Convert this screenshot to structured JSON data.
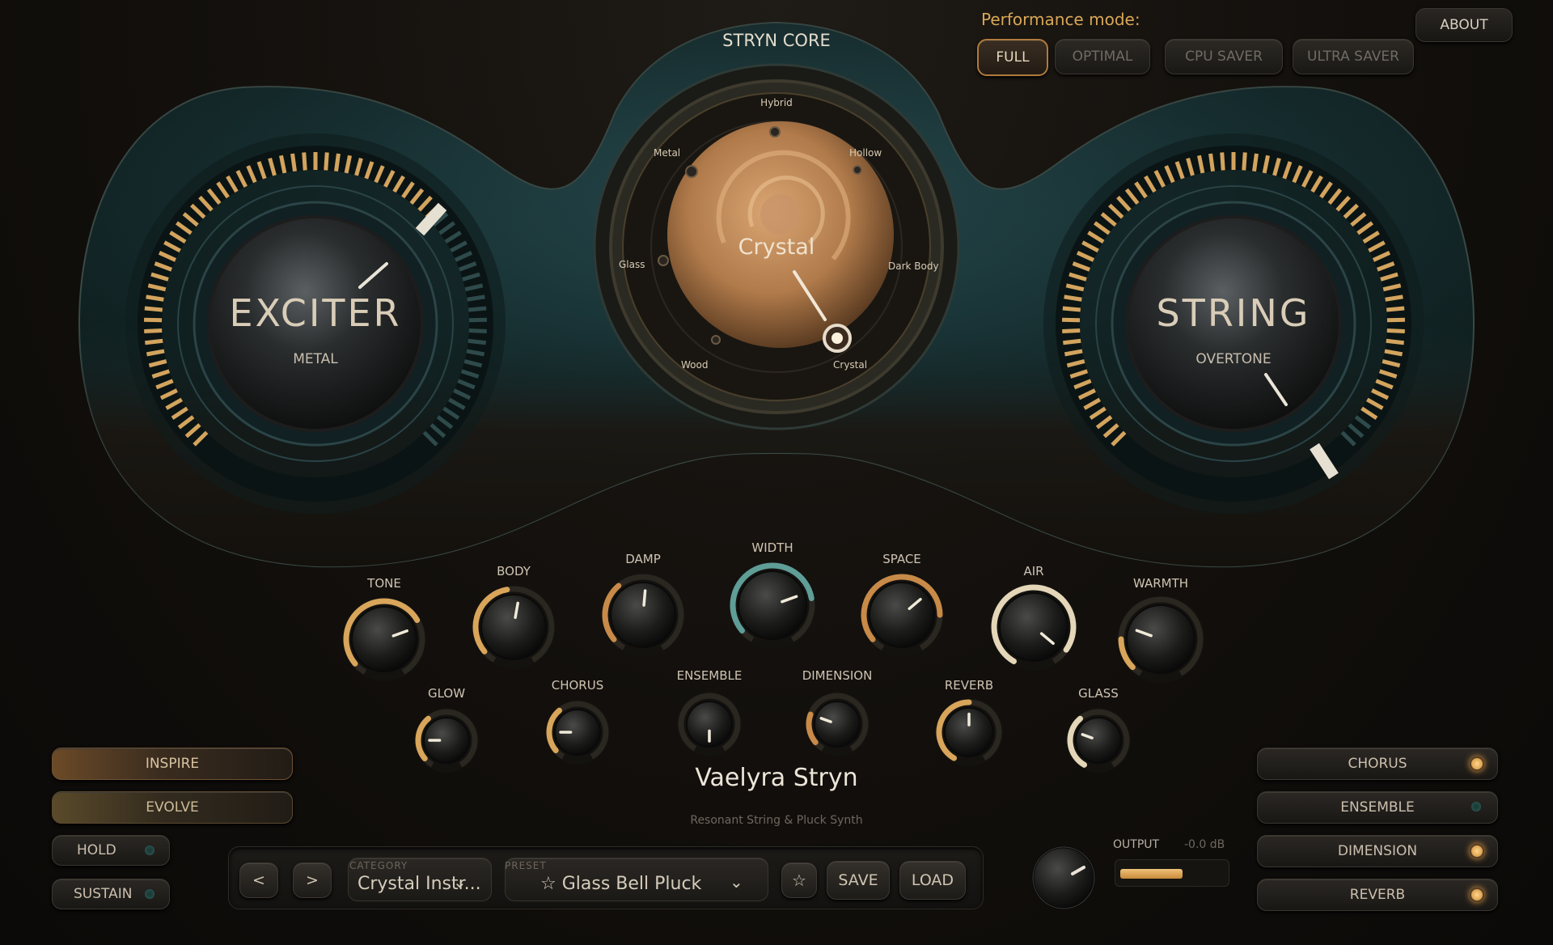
{
  "performance": {
    "title": "Performance mode:",
    "modes": [
      "FULL",
      "OPTIMAL",
      "CPU SAVER",
      "ULTRA SAVER"
    ],
    "active": "FULL"
  },
  "about_label": "ABOUT",
  "core": {
    "title": "STRYN CORE",
    "current": "Crystal",
    "points": [
      "Hybrid",
      "Hollow",
      "Dark Body",
      "Crystal",
      "Wood",
      "Glass",
      "Metal"
    ]
  },
  "exciter": {
    "title": "EXCITER",
    "type": "METAL"
  },
  "string": {
    "title": "STRING",
    "type": "OVERTONE"
  },
  "knobs": {
    "tone": "TONE",
    "body": "BODY",
    "damp": "DAMP",
    "width": "WIDTH",
    "space": "SPACE",
    "air": "AIR",
    "warmth": "WARMTH",
    "glow": "GLOW",
    "chorus": "CHORUS",
    "ensemble": "ENSEMBLE",
    "dimension": "DIMENSION",
    "reverb": "REVERB",
    "glass": "GLASS"
  },
  "left_buttons": {
    "inspire": "INSPIRE",
    "evolve": "EVOLVE",
    "hold": "HOLD",
    "sustain": "SUSTAIN"
  },
  "right_buttons": {
    "chorus": "CHORUS",
    "ensemble": "ENSEMBLE",
    "dimension": "DIMENSION",
    "reverb": "REVERB"
  },
  "effects_on": {
    "chorus": true,
    "ensemble": false,
    "dimension": true,
    "reverb": true
  },
  "product": {
    "name": "Vaelyra Stryn",
    "subtitle": "Resonant String & Pluck Synth"
  },
  "preset_bar": {
    "prev": "<",
    "next": ">",
    "category_label": "CATEGORY",
    "category_value": "Crystal Instr...",
    "preset_label": "PRESET",
    "preset_value": "☆ Glass Bell Pluck",
    "favorite": "☆",
    "save": "SAVE",
    "load": "LOAD"
  },
  "output": {
    "label": "OUTPUT",
    "db": "-0.0 dB",
    "level": 0.6
  },
  "colors": {
    "accent": "#d9a757",
    "teal": "#6fb3a8",
    "panel": "#1b3a3c"
  }
}
